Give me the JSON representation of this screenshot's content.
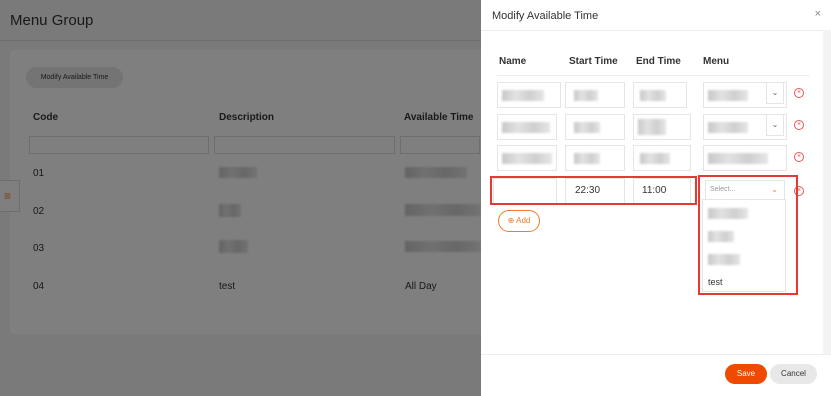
{
  "background": {
    "title": "Menu Group",
    "modify_button": "Modify Available Time",
    "columns": [
      "Code",
      "Description",
      "Available Time"
    ],
    "rows": [
      {
        "code": "01",
        "description": "",
        "available_time": ""
      },
      {
        "code": "02",
        "description": "",
        "available_time": ""
      },
      {
        "code": "03",
        "description": "",
        "available_time": ""
      },
      {
        "code": "04",
        "description": "test",
        "available_time": "All Day"
      }
    ]
  },
  "modal": {
    "title": "Modify Available Time",
    "close_icon": "×",
    "columns": [
      "Name",
      "Start Time",
      "End Time",
      "Menu"
    ],
    "new_row": {
      "name": "",
      "start_time": "22:30",
      "end_time": "11:00",
      "menu_placeholder": "Select..."
    },
    "menu_options": [
      "",
      "",
      "",
      "test"
    ],
    "add_label": "Add",
    "save_label": "Save",
    "cancel_label": "Cancel"
  },
  "colors": {
    "accent": "#f27b2c",
    "save": "#f04a00",
    "highlight": "#e53935"
  }
}
